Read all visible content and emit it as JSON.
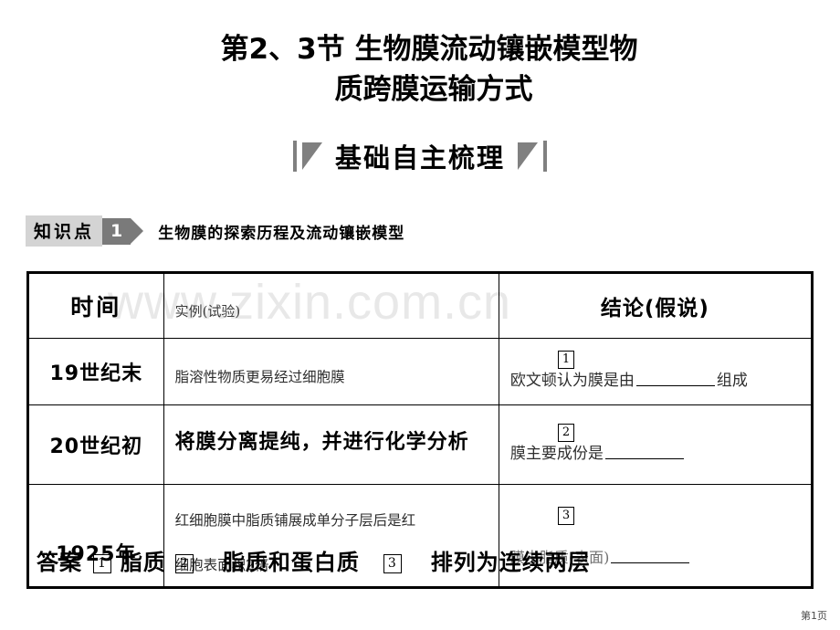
{
  "slide": {
    "title_line1": "第2、3节  生物膜流动镶嵌模型物",
    "title_line2": "质跨膜运输方式",
    "section_header": "基础自主梳理",
    "watermark": "www.zixin.com.cn",
    "page_label": "第1页"
  },
  "knowledge_point": {
    "label": "知识点",
    "number": "1",
    "title": "生物膜的探索历程及流动镶嵌模型"
  },
  "table": {
    "headers": {
      "time": "时间",
      "example": "实例(试验)",
      "conclusion": "结论(假说)"
    },
    "rows": [
      {
        "era": "19世纪末",
        "example": "脂溶性物质更易经过细胞膜",
        "conclusion_marker": "1",
        "conclusion_prefix": "欧文顿认为膜是由",
        "conclusion_suffix": "组成"
      },
      {
        "era": "20世纪初",
        "example": "将膜分离提纯，并进行化学分析",
        "conclusion_marker": "2",
        "conclusion_prefix": "膜主要成份是",
        "conclusion_suffix": ""
      },
      {
        "era": "1925年",
        "example_line1": "红细胞膜中脂质铺展成单分子层后是红",
        "example_line2": "细胞表面积2倍",
        "conclusion_marker": "3",
        "conclusion_prefix": "膜中脂质(表面)",
        "conclusion_suffix": ""
      }
    ]
  },
  "answer_overlay": {
    "label": "答案",
    "mark1": "1",
    "item1": "脂质",
    "mark2": "2",
    "item2": "脂质和蛋白质",
    "mark3": "3",
    "item3": "排列为连续两层"
  }
}
